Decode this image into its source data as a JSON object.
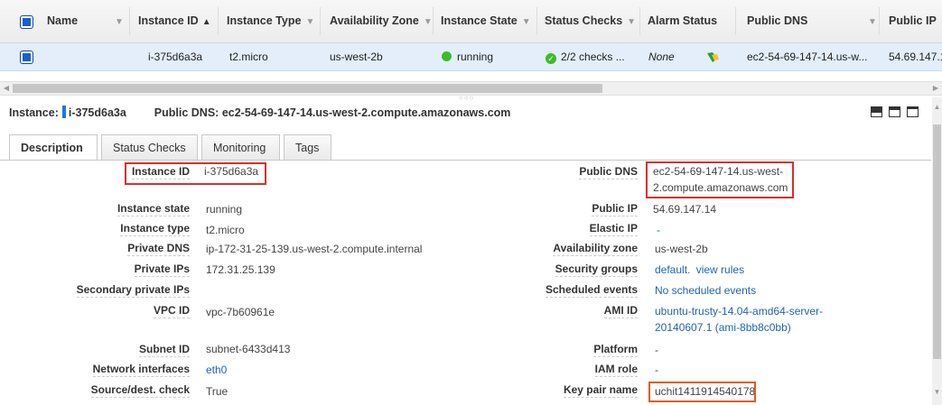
{
  "columns": {
    "name": "Name",
    "instance_id": "Instance ID",
    "instance_type": "Instance Type",
    "availability_zone": "Availability Zone",
    "instance_state": "Instance State",
    "status_checks": "Status Checks",
    "alarm_status": "Alarm Status",
    "public_dns": "Public DNS",
    "public_ip": "Public IP"
  },
  "row": {
    "instance_id": "i-375d6a3a",
    "instance_type": "t2.micro",
    "availability_zone": "us-west-2b",
    "instance_state": "running",
    "status_checks": "2/2 checks ...",
    "alarm_status": "None",
    "public_dns": "ec2-54-69-147-14.us-w...",
    "public_ip": "54.69.147.1"
  },
  "detail_header": {
    "instance_label": "Instance:",
    "instance_id": "i-375d6a3a",
    "public_dns_label": "Public DNS:",
    "public_dns": "ec2-54-69-147-14.us-west-2.compute.amazonaws.com"
  },
  "tabs": [
    "Description",
    "Status Checks",
    "Monitoring",
    "Tags"
  ],
  "left_fields": [
    {
      "label": "Instance ID",
      "value": "i-375d6a3a"
    },
    {
      "label": "Instance state",
      "value": "running"
    },
    {
      "label": "Instance type",
      "value": "t2.micro"
    },
    {
      "label": "Private DNS",
      "value": "ip-172-31-25-139.us-west-2.compute.internal"
    },
    {
      "label": "Private IPs",
      "value": "172.31.25.139"
    },
    {
      "label": "Secondary private IPs",
      "value": ""
    },
    {
      "label": "VPC ID",
      "value": "vpc-7b60961e"
    },
    {
      "label": "Subnet ID",
      "value": "subnet-6433d413"
    },
    {
      "label": "Network interfaces",
      "value": "eth0"
    },
    {
      "label": "Source/dest. check",
      "value": "True"
    }
  ],
  "right_fields": [
    {
      "label": "Public DNS",
      "value": "ec2-54-69-147-14.us-west-",
      "value2": "2.compute.amazonaws.com"
    },
    {
      "label": "Public IP",
      "value": "54.69.147.14"
    },
    {
      "label": "Elastic IP",
      "value": "-"
    },
    {
      "label": "Availability zone",
      "value": "us-west-2b"
    },
    {
      "label": "Security groups",
      "value": "default.",
      "value_link": "view rules"
    },
    {
      "label": "Scheduled events",
      "value": "No scheduled events"
    },
    {
      "label": "AMI ID",
      "value": "ubuntu-trusty-14.04-amd64-server-",
      "value2": "20140607.1 (ami-8bb8c0bb)"
    },
    {
      "label": "Platform",
      "value": "-"
    },
    {
      "label": "IAM role",
      "value": "-"
    },
    {
      "label": "Key pair name",
      "value": "uchit1411914540178"
    }
  ],
  "colors": {
    "accent": "#1f66d2",
    "running": "#3bbd27",
    "highlight": "#d9302a",
    "link": "#1f63b8"
  },
  "icons": [
    "checkbox-icon",
    "sort-up-icon",
    "chevron-down-icon",
    "running-dot-icon",
    "check-circle-icon",
    "alarm-bell-icon",
    "view-icons"
  ]
}
